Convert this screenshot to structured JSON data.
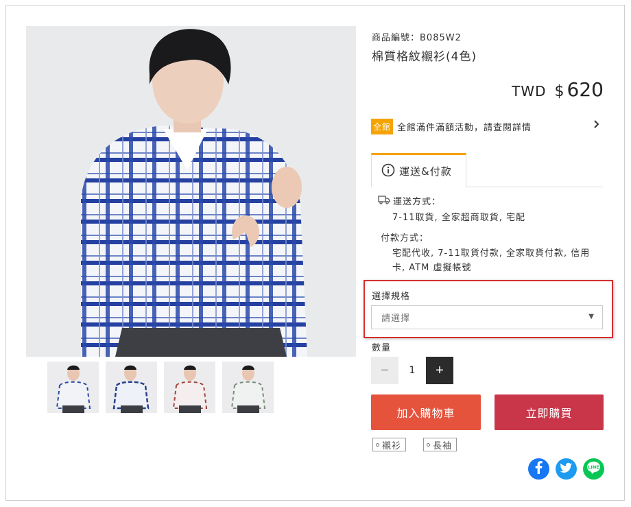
{
  "product": {
    "code_label": "商品編號：B085W2",
    "title": "棉質格紋襯衫(4色)",
    "currency": "TWD",
    "currency_symbol": "$",
    "price": "620"
  },
  "promo": {
    "badge": "全館",
    "text": "全館滿件滿額活動，請查閱詳情",
    "badge_color": "#f5a300"
  },
  "tab": {
    "label": "運送&付款",
    "icon": "info-circle-icon"
  },
  "shipping": {
    "heading": "運送方式：",
    "value": "7-11取貨, 全家超商取貨, 宅配",
    "icon": "truck-icon"
  },
  "payment": {
    "heading": "付款方式：",
    "value": "宅配代收, 7-11取貨付款, 全家取貨付款, 信用卡, ATM 虛擬帳號"
  },
  "spec": {
    "label": "選擇規格",
    "placeholder": "請選擇"
  },
  "quantity": {
    "label": "數量",
    "value": "1",
    "minus": "−",
    "plus": "+"
  },
  "actions": {
    "add_to_cart": "加入購物車",
    "buy_now": "立即購買",
    "cart_color": "#e5533d",
    "buy_color": "#c9364a"
  },
  "tags": [
    "襯衫",
    "長袖"
  ],
  "share": [
    {
      "name": "facebook-icon",
      "color": "#1877f2"
    },
    {
      "name": "twitter-icon",
      "color": "#1d9bf0"
    },
    {
      "name": "line-icon",
      "color": "#06c755",
      "text": "LINE"
    }
  ],
  "thumbnails": [
    {
      "shirt_color": "#2b4aa3"
    },
    {
      "shirt_color": "#253f8f"
    },
    {
      "shirt_color": "#a3443c"
    },
    {
      "shirt_color": "#7a8c80"
    }
  ]
}
